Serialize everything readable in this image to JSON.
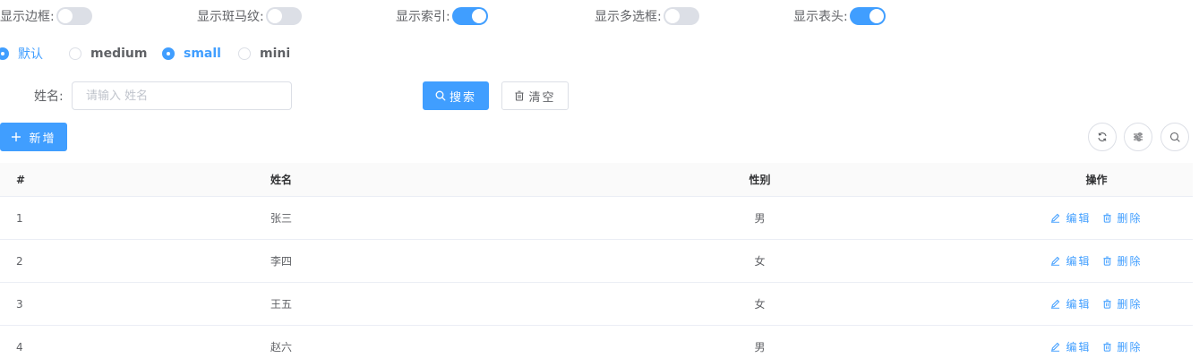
{
  "toggles": [
    {
      "label": "显示边框:",
      "on": false
    },
    {
      "label": "显示斑马纹:",
      "on": false
    },
    {
      "label": "显示索引:",
      "on": true
    },
    {
      "label": "显示多选框:",
      "on": false
    },
    {
      "label": "显示表头:",
      "on": true
    }
  ],
  "sizes": [
    {
      "label": "默认",
      "checked": true
    },
    {
      "label": "medium",
      "checked": false
    },
    {
      "label": "small",
      "checked": true
    },
    {
      "label": "mini",
      "checked": false
    }
  ],
  "search": {
    "name_label": "姓名:",
    "name_placeholder": "请输入 姓名",
    "search_label": "搜索",
    "clear_label": "清空"
  },
  "toolbar": {
    "add_label": "新增"
  },
  "table": {
    "headers": {
      "index": "#",
      "name": "姓名",
      "gender": "性别",
      "actions": "操作"
    },
    "edit_label": "编辑",
    "delete_label": "删除",
    "rows": [
      {
        "index": "1",
        "name": "张三",
        "gender": "男"
      },
      {
        "index": "2",
        "name": "李四",
        "gender": "女"
      },
      {
        "index": "3",
        "name": "王五",
        "gender": "女"
      },
      {
        "index": "4",
        "name": "赵六",
        "gender": "男"
      }
    ]
  },
  "colors": {
    "primary": "#409eff",
    "border": "#dcdfe6",
    "text": "#606266"
  }
}
